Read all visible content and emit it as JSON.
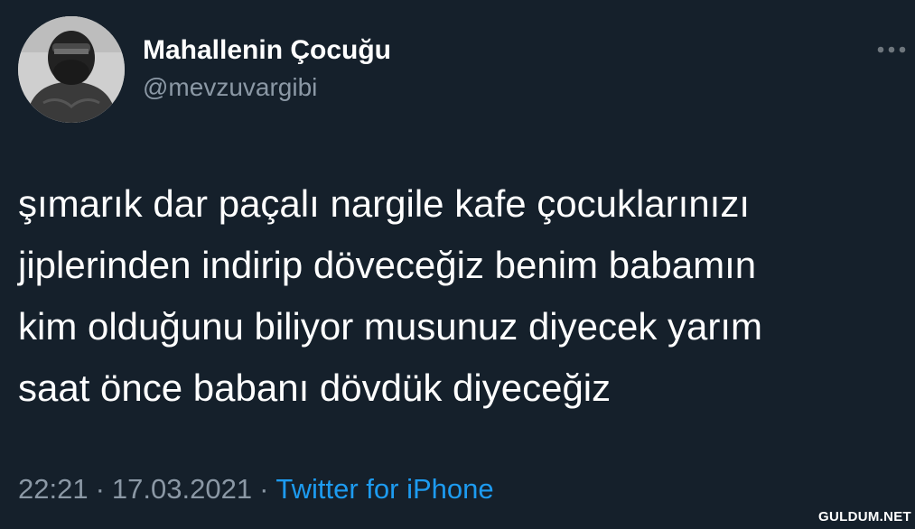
{
  "user": {
    "display_name": "Mahallenin Çocuğu",
    "handle": "@mevzuvargibi"
  },
  "tweet": {
    "text": "şımarık dar paçalı nargile kafe çocuklarınızı\njiplerinden indirip döveceğiz benim babamın\nkim olduğunu biliyor musunuz diyecek yarım\nsaat önce babanı dövdük diyeceğiz",
    "time": "22:21",
    "date": "17.03.2021",
    "separator": "·",
    "source": "Twitter for iPhone"
  },
  "icons": {
    "more": "more-horizontal-icon",
    "avatar": "masked-person-avatar"
  },
  "colors": {
    "background": "#15202b",
    "text": "#ffffff",
    "secondary": "#8b98a5",
    "link": "#1d9bf0"
  },
  "watermark": "GULDUM.NET"
}
